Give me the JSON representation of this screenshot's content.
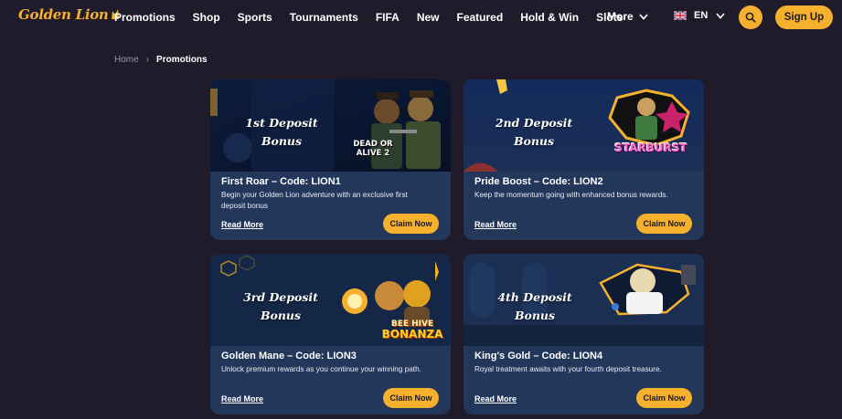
{
  "brand": {
    "name": "Golden Lion",
    "accent": "#f5b12e"
  },
  "nav": {
    "items": [
      "Promotions",
      "Shop",
      "Sports",
      "Tournaments",
      "FIFA",
      "New",
      "Featured",
      "Hold & Win",
      "Slots"
    ],
    "more_label": "More",
    "language": "EN",
    "search_icon": "search-icon",
    "signup_label": "Sign Up"
  },
  "breadcrumb": {
    "home": "Home",
    "separator": "›",
    "current": "Promotions"
  },
  "promotions": [
    {
      "banner_line1": "1st Deposit",
      "banner_line2": "Bonus",
      "game_logo_line1": "DEAD OR",
      "game_logo_line2": "ALIVE 2",
      "title": "First Roar – Code: LION1",
      "description": "Begin your Golden Lion adventure with an exclusive first deposit bonus",
      "read_more": "Read More",
      "claim": "Claim Now"
    },
    {
      "banner_line1": "2nd Deposit",
      "banner_line2": "Bonus",
      "game_logo_line1": "STARBURST",
      "game_logo_line2": "",
      "title": "Pride Boost – Code: LION2",
      "description": "Keep the momentum going with enhanced bonus rewards.",
      "read_more": "Read More",
      "claim": "Claim Now"
    },
    {
      "banner_line1": "3rd Deposit",
      "banner_line2": "Bonus",
      "game_logo_line1": "BEE HIVE",
      "game_logo_line2": "BONANZA",
      "title": "Golden Mane – Code: LION3",
      "description": "Unlock premium rewards as you continue your winning path.",
      "read_more": "Read More",
      "claim": "Claim Now"
    },
    {
      "banner_line1": "4th Deposit",
      "banner_line2": "Bonus",
      "game_logo_line1": "",
      "game_logo_line2": "",
      "title": "King's Gold – Code: LION4",
      "description": "Royal treatment awaits with your fourth deposit treasure.",
      "read_more": "Read More",
      "claim": "Claim Now"
    }
  ]
}
